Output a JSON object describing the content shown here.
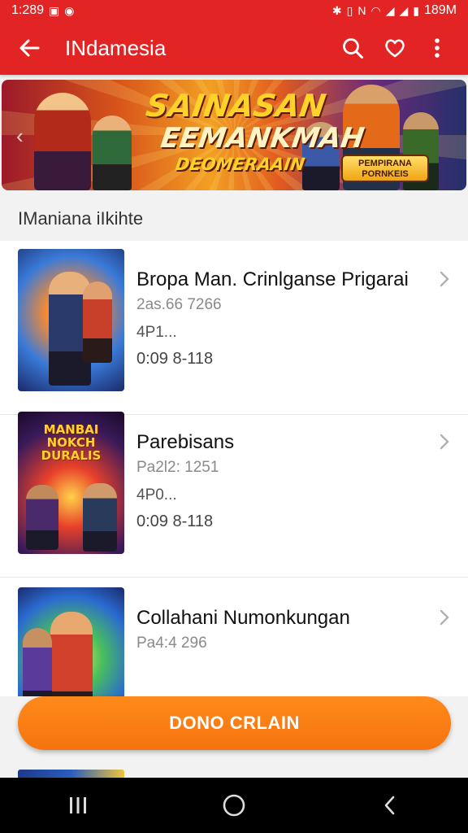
{
  "status": {
    "time": "1:289",
    "battery": "189M"
  },
  "appbar": {
    "title": "INdamesia"
  },
  "banner": {
    "line1": "SAINASAN",
    "line2": "EEMANKMAH",
    "line3": "DEOMERAAIN",
    "badge": "PEMPIRANA PORNKEIS"
  },
  "section": {
    "title": "IManiana iIkihte"
  },
  "items": [
    {
      "name": "Bropa Man. Crinlganse Prigarai",
      "meta1": "2as.66 7266",
      "meta2": "4P1...",
      "meta3": "0:09 8-118"
    },
    {
      "name": "Parebisans",
      "meta1": "Pa2l2: 1251",
      "meta2": "4P0...",
      "meta3": "0:09 8-118"
    },
    {
      "name": "Collahani Numonkungan",
      "meta1": "Pa4:4 296",
      "meta2": "",
      "meta3": ""
    }
  ],
  "thumb2_text": "MANBAI NOKCH DURALIS",
  "cta": {
    "label": "DONO CRLAIN"
  },
  "colors": {
    "primary": "#e32424",
    "accent": "#f57310"
  }
}
